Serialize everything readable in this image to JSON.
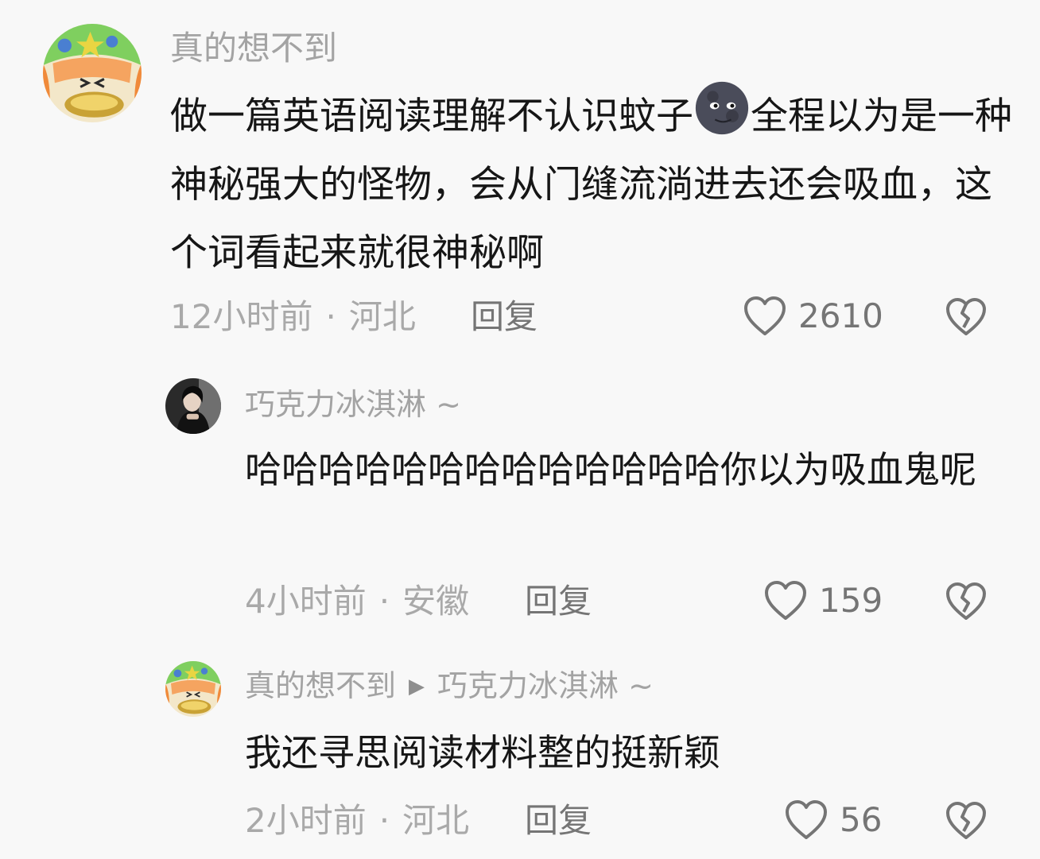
{
  "comments": [
    {
      "username": "真的想不到",
      "text_before_emoji": "做一篇英语阅读理解不认识蚊子",
      "emoji": "new-moon-face",
      "text_after_emoji": "全程以为是一种神秘强大的怪物，会从门缝流淌进去还会吸血，这个词看起来就很神秘啊",
      "time": "12小时前",
      "location": "河北",
      "reply_label": "回复",
      "likes": "2610"
    },
    {
      "username": "巧克力冰淇淋 ~",
      "text": "哈哈哈哈哈哈哈哈哈哈哈哈哈你以为吸血鬼呢",
      "time": "4小时前",
      "location": "安徽",
      "reply_label": "回复",
      "likes": "159"
    },
    {
      "username": "真的想不到",
      "reply_to": "巧克力冰淇淋 ~",
      "text": "我还寻思阅读材料整的挺新颖",
      "time": "2小时前",
      "location": "河北",
      "reply_label": "回复",
      "likes": "56"
    }
  ],
  "separator_dot": "·",
  "colors": {
    "username": "#a3a3a3",
    "text": "#161616",
    "meta": "#a9a9a9",
    "action": "#757575"
  },
  "icons": {
    "like": "heart-outline-icon",
    "dislike": "broken-heart-icon",
    "reply_arrow": "triangle-right-icon"
  }
}
